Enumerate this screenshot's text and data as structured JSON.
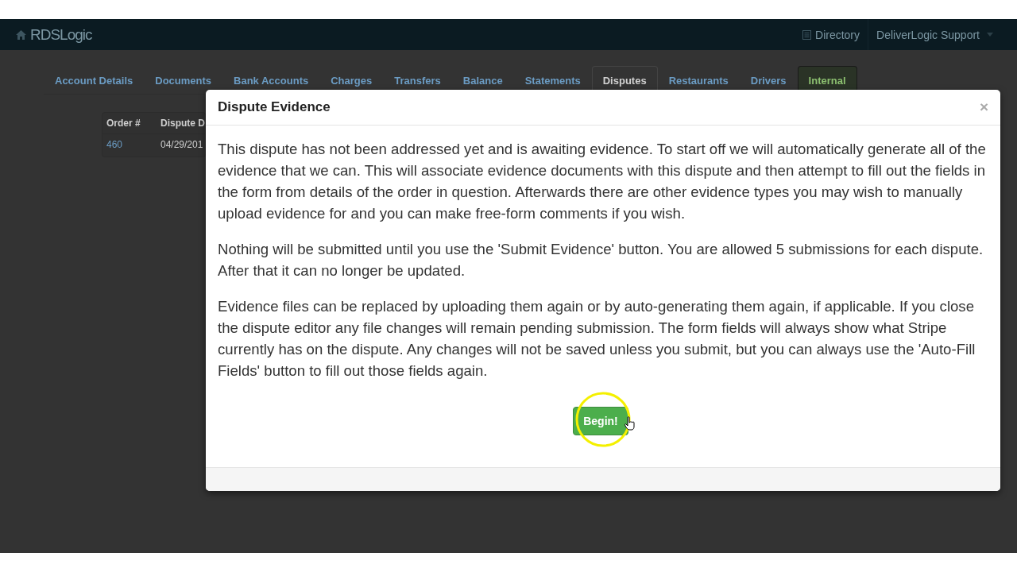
{
  "navbar": {
    "brand": "RDSLogic",
    "links": [
      {
        "label": "Directory",
        "kind": "directory"
      },
      {
        "label": "DeliverLogic Support",
        "kind": "dropdown"
      }
    ]
  },
  "tabs": [
    {
      "label": "Account Details",
      "selected": false,
      "kind": "tab"
    },
    {
      "label": "Documents",
      "selected": false,
      "kind": "tab"
    },
    {
      "label": "Bank Accounts",
      "selected": false,
      "kind": "tab"
    },
    {
      "label": "Charges",
      "selected": false,
      "kind": "tab"
    },
    {
      "label": "Transfers",
      "selected": false,
      "kind": "tab"
    },
    {
      "label": "Balance",
      "selected": false,
      "kind": "tab"
    },
    {
      "label": "Statements",
      "selected": false,
      "kind": "tab"
    },
    {
      "label": "Disputes",
      "selected": true,
      "kind": "tab"
    },
    {
      "label": "Restaurants",
      "selected": false,
      "kind": "tab"
    },
    {
      "label": "Drivers",
      "selected": false,
      "kind": "tab"
    },
    {
      "label": "Internal",
      "selected": false,
      "kind": "internal"
    }
  ],
  "table": {
    "columns": [
      "Order #",
      "Dispute D"
    ],
    "rows": [
      [
        "460",
        "04/29/201"
      ]
    ]
  },
  "modal": {
    "title": "Dispute Evidence",
    "close": "×",
    "paragraphs": [
      "This dispute has not been addressed yet and is awaiting evidence. To start off we will automatically generate all of the evidence that we can. This will associate evidence documents with this dispute and then attempt to fill out the fields in the form from details of the order in question. Afterwards there are other evidence types you may wish to manually upload evidence for and you can make free-form comments if you wish.",
      "Nothing will be submitted until you use the 'Submit Evidence' button. You are allowed 5 submissions for each dispute. After that it can no longer be updated.",
      "Evidence files can be replaced by uploading them again or by auto-generating them again, if applicable. If you close the dispute editor any file changes will remain pending submission. The form fields will always show what Stripe currently has on the dispute. Any changes will not be saved unless you submit, but you can always use the 'Auto-Fill Fields' button to fill out those fields again."
    ],
    "button": "Begin!"
  }
}
